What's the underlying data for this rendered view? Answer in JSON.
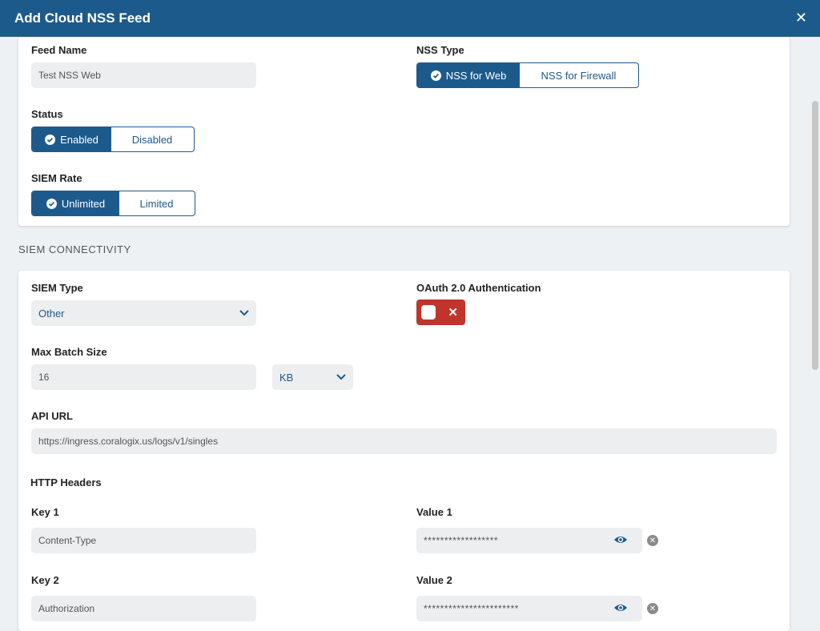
{
  "header": {
    "title": "Add Cloud NSS Feed",
    "close_icon": "close-icon"
  },
  "feed": {
    "feed_name_label": "Feed Name",
    "feed_name_value": "Test NSS Web",
    "nss_type_label": "NSS Type",
    "nss_type_options": [
      "NSS for Web",
      "NSS for Firewall"
    ],
    "nss_type_selected": "NSS for Web",
    "status_label": "Status",
    "status_options": [
      "Enabled",
      "Disabled"
    ],
    "status_selected": "Enabled",
    "siem_rate_label": "SIEM Rate",
    "siem_rate_options": [
      "Unlimited",
      "Limited"
    ],
    "siem_rate_selected": "Unlimited"
  },
  "section_title": "SIEM CONNECTIVITY",
  "siem": {
    "siem_type_label": "SIEM Type",
    "siem_type_value": "Other",
    "oauth_label": "OAuth 2.0 Authentication",
    "oauth_enabled": false,
    "max_batch_label": "Max Batch Size",
    "max_batch_value": "16",
    "max_batch_unit": "KB",
    "api_url_label": "API URL",
    "api_url_value": "https://ingress.coralogix.us/logs/v1/singles",
    "http_headers_label": "HTTP Headers",
    "headers": [
      {
        "key_label": "Key 1",
        "key_value": "Content-Type",
        "value_label": "Value 1",
        "value_masked": "******************"
      },
      {
        "key_label": "Key 2",
        "key_value": "Authorization",
        "value_label": "Value 2",
        "value_masked": "***********************"
      }
    ]
  },
  "colors": {
    "brand": "#1d5a8c",
    "toggle_off": "#c0342b"
  }
}
